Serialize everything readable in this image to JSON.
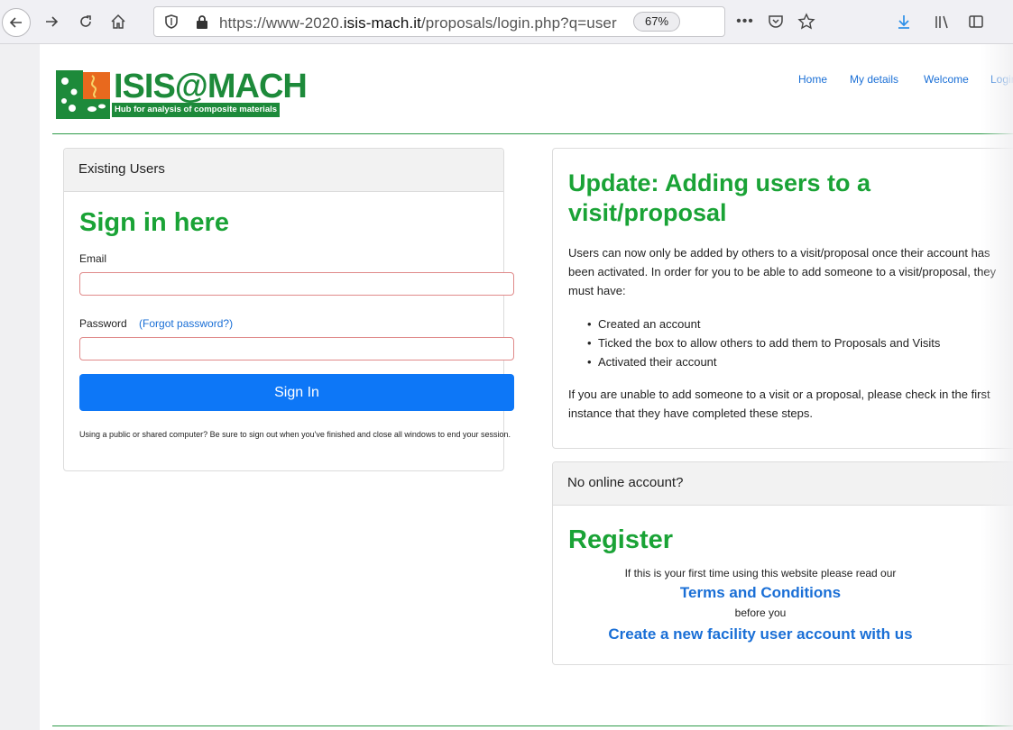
{
  "browser": {
    "url_prefix": "https://www-2020.",
    "url_domain": "isis-mach.it",
    "url_path": "/proposals/login.php?q=user",
    "zoom": "67%"
  },
  "header": {
    "logo_title": "ISIS@MACH",
    "logo_subtitle": "Hub for analysis of composite materials",
    "nav": [
      "Home",
      "My details",
      "Welcome",
      "Login"
    ]
  },
  "login": {
    "card_title": "Existing Users",
    "heading": "Sign in here",
    "email_label": "Email",
    "password_label": "Password",
    "forgot_link": "(Forgot password?)",
    "submit_label": "Sign In",
    "notice": "Using a public or shared computer? Be sure to sign out when you've finished and close all windows to end your session."
  },
  "update": {
    "heading": "Update: Adding users to a visit/proposal",
    "intro": "Users can now only be added by others to a visit/proposal once their account has been activated. In order for you to be able to add someone to a visit/proposal, they must have:",
    "bullets": [
      "Created an account",
      "Ticked the box to allow others to add them to Proposals and Visits",
      "Activated their account"
    ],
    "outro": "If you are unable to add someone to a visit or a proposal, please check in the first instance that they have completed these steps."
  },
  "register": {
    "card_title": "No online account?",
    "heading": "Register",
    "line1": "If this is your first time using this website please read our",
    "terms_link": "Terms and Conditions",
    "line2": "before you",
    "create_link": "Create a new facility user account with us"
  },
  "colors": {
    "accent_green": "#1aa336",
    "link_blue": "#1a6fd6",
    "button_blue": "#0d77f7"
  }
}
